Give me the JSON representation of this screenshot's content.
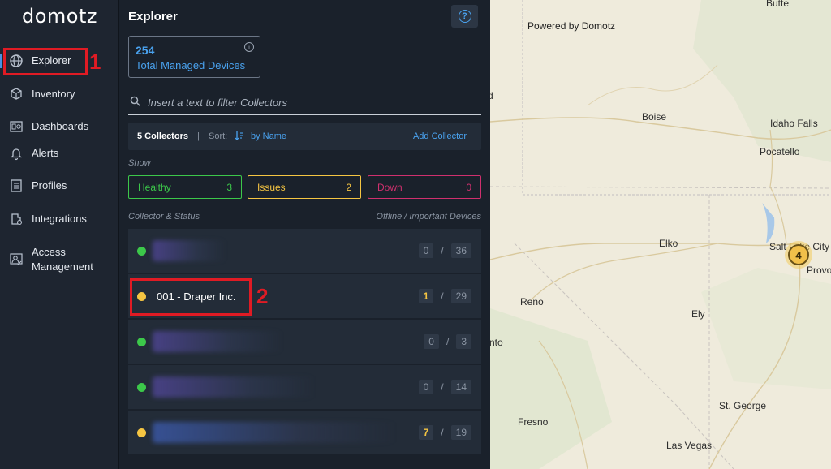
{
  "app": {
    "logo": "domotz"
  },
  "nav": {
    "items": [
      {
        "label": "Explorer",
        "icon": "globe-icon",
        "active": true
      },
      {
        "label": "Inventory",
        "icon": "cubes-icon"
      },
      {
        "label": "Dashboards",
        "icon": "dashboard-icon"
      },
      {
        "label": "Alerts",
        "icon": "bell-icon"
      },
      {
        "label": "Profiles",
        "icon": "checklist-icon"
      },
      {
        "label": "Integrations",
        "icon": "integrations-icon"
      },
      {
        "label": "Access\nManagement",
        "icon": "user-key-icon"
      }
    ]
  },
  "annotations": {
    "one": "1",
    "two": "2",
    "color": "#e01b24"
  },
  "explorer": {
    "title": "Explorer",
    "help": "?",
    "kpi": {
      "value": "254",
      "label": "Total Managed Devices",
      "info": "i"
    },
    "search_placeholder": "Insert a text to filter Collectors",
    "toolbar": {
      "count": "5 Collectors",
      "sep": "|",
      "sort_label": "Sort:",
      "sort_value": "by Name",
      "add": "Add Collector"
    },
    "show_label": "Show",
    "filters": {
      "healthy": {
        "label": "Healthy",
        "count": "3"
      },
      "issues": {
        "label": "Issues",
        "count": "2"
      },
      "down": {
        "label": "Down",
        "count": "0"
      }
    },
    "col_left": "Collector & Status",
    "col_right": "Offline / Important Devices",
    "rows": [
      {
        "name": "",
        "status": "healthy",
        "offline": "0",
        "important": "36"
      },
      {
        "name": "001 - Draper Inc.",
        "status": "issues",
        "offline": "1",
        "important": "29"
      },
      {
        "name": "",
        "status": "healthy",
        "offline": "0",
        "important": "3"
      },
      {
        "name": "",
        "status": "healthy",
        "offline": "0",
        "important": "14"
      },
      {
        "name": "",
        "status": "issues",
        "offline": "7",
        "important": "19"
      }
    ]
  },
  "colors": {
    "healthy": "#3cc84a",
    "issues": "#f5c542",
    "down": "#d0306e",
    "accent": "#4aa3f0"
  },
  "map": {
    "powered": "Powered by Domotz",
    "cities": [
      "Butte",
      "Boise",
      "Idaho Falls",
      "Pocatello",
      "Elko",
      "Salt Lake City",
      "Provo",
      "Reno",
      "Ely",
      "St. George",
      "Fresno",
      "Las Vegas",
      "nto",
      "d"
    ],
    "cluster_count": "4"
  }
}
